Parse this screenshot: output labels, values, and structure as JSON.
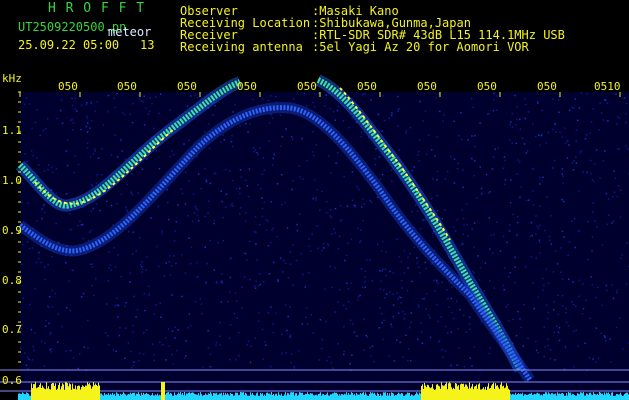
{
  "header": {
    "app_title": "H R O F F T",
    "filename": "UT2509220500.pn",
    "mode": "meteor",
    "datetime": "25.09.22 05:00",
    "count": "13",
    "fields": [
      {
        "label": "Observer",
        "value": ":Masaki Kano"
      },
      {
        "label": "Receiving Location",
        "value": ":Shibukawa,Gunma,Japan"
      },
      {
        "label": "Receiver",
        "value": ":RTL-SDR SDR# 43dB L15 114.1MHz USB"
      },
      {
        "label": "Receiving antenna",
        "value": ":5el Yagi Az 20 for Aomori VOR"
      }
    ]
  },
  "axis": {
    "unit": "kHz",
    "y_ticks": [
      "1.1",
      "1.0",
      "0.9",
      "0.8",
      "0.7",
      "0.6"
    ],
    "time_ticks": [
      "050",
      "050",
      "050",
      "050",
      "050",
      "050",
      "050",
      "050",
      "050",
      "0510"
    ]
  },
  "colors": {
    "background": "#00003a",
    "trace_hot": "#ffff40",
    "trace_warm": "#38e8a0",
    "trace_cool": "#2a64ff",
    "level_yellow": "#f6f31a",
    "level_cyan": "#22d6ff"
  }
}
